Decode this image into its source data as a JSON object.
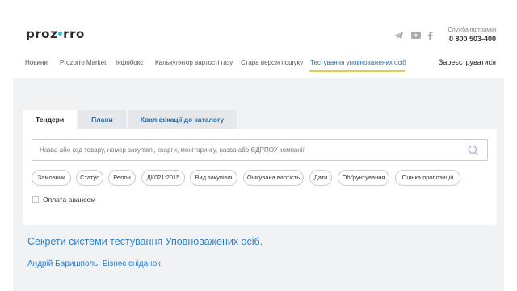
{
  "header": {
    "logo_left": "proz",
    "logo_right": "rro",
    "support_label": "Служба підтримки",
    "support_phone": "0 800 503-400",
    "social_icons": [
      "telegram-icon",
      "youtube-icon",
      "facebook-icon"
    ]
  },
  "nav": {
    "items": [
      {
        "label": "Новини"
      },
      {
        "label": "Prozorro Market"
      },
      {
        "label": "Інфобокс"
      },
      {
        "label": "Калькулятор вартості газу"
      },
      {
        "label": "Стара версія пошуку"
      },
      {
        "label": "Тестування уповноважених осіб"
      }
    ],
    "active_index": 5,
    "register_label": "Зареєструватися"
  },
  "search": {
    "tabs": [
      {
        "label": "Тендери"
      },
      {
        "label": "Плани"
      },
      {
        "label": "Кваліфікації до каталогу"
      }
    ],
    "active_tab": 0,
    "placeholder": "Назва або код товару, номер закупівлі, скарги, моніторингу, назва або ЄДРПОУ компанії",
    "filters": [
      {
        "label": "Замовник"
      },
      {
        "label": "Статус"
      },
      {
        "label": "Регіон"
      },
      {
        "label": "ДК021:2015"
      },
      {
        "label": "Вид закупівлі"
      },
      {
        "label": "Очікувана вартість"
      },
      {
        "label": "Дати"
      },
      {
        "label": "Обґрунтування"
      },
      {
        "label": "Оцінка пропозицій"
      }
    ],
    "prepayment_label": "Оплата авансом"
  },
  "article": {
    "title": "Секрети системи тестування Уповноважених осіб.",
    "subtitle": "Андрій Баришполь. Бізнес сніданок"
  },
  "colors": {
    "accent_link": "#2e7fc8",
    "nav_active": "#2e6da4",
    "underline": "#e5c65a",
    "logo_dot": "#2fb8e8",
    "background": "#f1f2f4"
  }
}
